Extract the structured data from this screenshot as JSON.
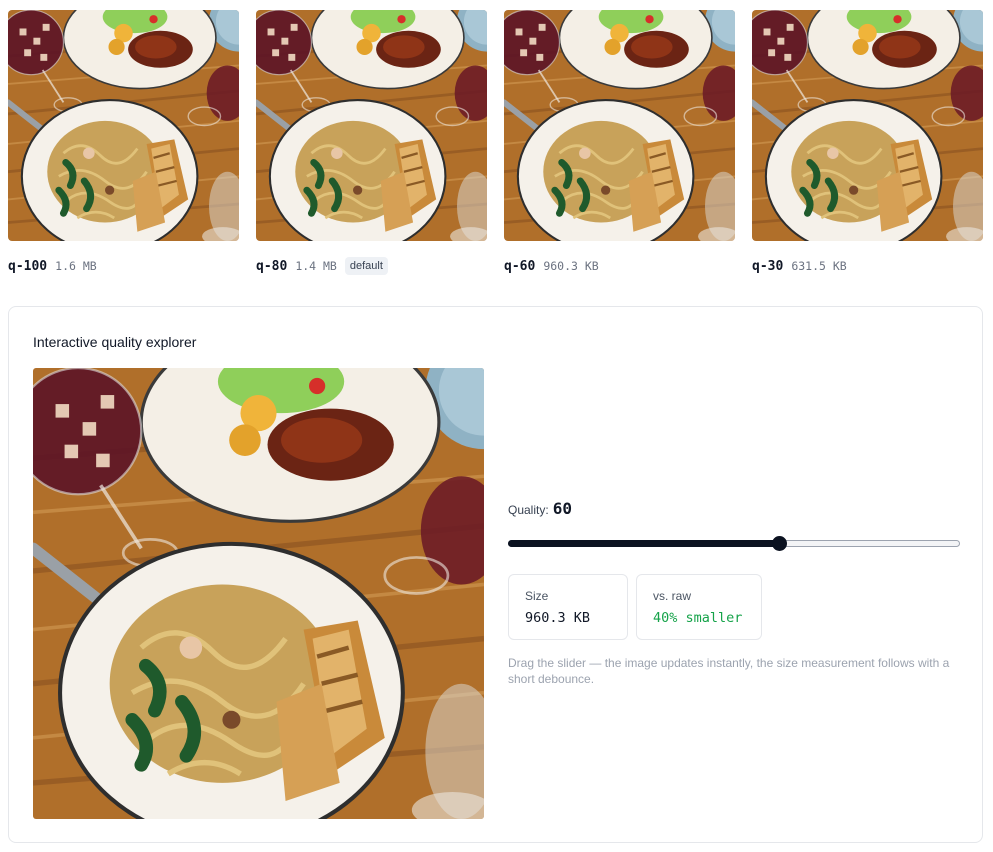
{
  "thumbnails": [
    {
      "label": "q-100",
      "size": "1.6 MB",
      "badge": ""
    },
    {
      "label": "q-80",
      "size": "1.4 MB",
      "badge": "default"
    },
    {
      "label": "q-60",
      "size": "960.3 KB",
      "badge": ""
    },
    {
      "label": "q-30",
      "size": "631.5 KB",
      "badge": ""
    }
  ],
  "explorer": {
    "title": "Interactive quality explorer",
    "quality_label": "Quality:",
    "quality_value": "60",
    "slider": {
      "min": 0,
      "max": 100,
      "value": 60
    },
    "size_label": "Size",
    "size_value": "960.3 KB",
    "vs_label": "vs. raw",
    "vs_value": "40% smaller",
    "hint": "Drag the slider — the image updates instantly, the size measurement follows with a short debounce."
  },
  "colors": {
    "accent": "#0b1220",
    "success": "#16a34a",
    "muted": "#9ca3af",
    "border": "#e5e7eb"
  },
  "image_subject": "food-photo-pasta-chicken-wine"
}
